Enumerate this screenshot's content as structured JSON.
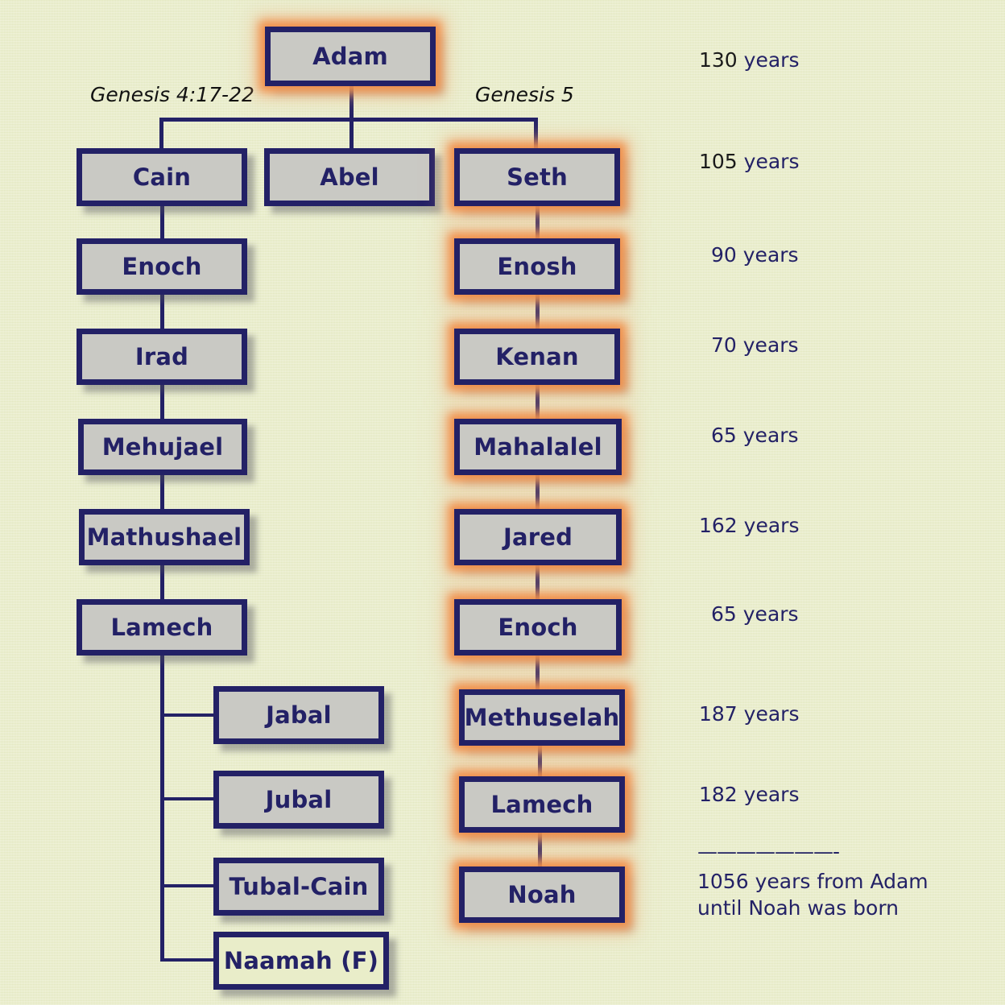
{
  "page": {
    "background_color": "#e9edc9",
    "box_fill": "#c9c9c4",
    "ink_color": "#232166",
    "glow_color": "#f08c46"
  },
  "captions": {
    "left": "Genesis 4:17-22",
    "right": "Genesis 5"
  },
  "root": {
    "label": "Adam"
  },
  "sons": [
    {
      "label": "Cain"
    },
    {
      "label": "Abel"
    },
    {
      "label": "Seth"
    }
  ],
  "cain_line": [
    {
      "label": "Enoch"
    },
    {
      "label": "Irad"
    },
    {
      "label": "Mehujael"
    },
    {
      "label": "Mathushael"
    },
    {
      "label": "Lamech"
    }
  ],
  "lamech_children": [
    {
      "label": "Jabal"
    },
    {
      "label": "Jubal"
    },
    {
      "label": "Tubal-Cain"
    },
    {
      "label": "Naamah (F)"
    }
  ],
  "seth_line": [
    {
      "label": "Enosh"
    },
    {
      "label": "Kenan"
    },
    {
      "label": "Mahalalel"
    },
    {
      "label": "Jared"
    },
    {
      "label": "Enoch"
    },
    {
      "label": "Methuselah"
    },
    {
      "label": "Lamech"
    },
    {
      "label": "Noah"
    }
  ],
  "years": [
    {
      "number": "130",
      "unit": "years"
    },
    {
      "number": "105",
      "unit": "years"
    },
    {
      "number": "90",
      "unit": "years"
    },
    {
      "number": "70",
      "unit": "years"
    },
    {
      "number": "65",
      "unit": "years"
    },
    {
      "number": "162",
      "unit": "years"
    },
    {
      "number": "65",
      "unit": "years"
    },
    {
      "number": "187",
      "unit": "years"
    },
    {
      "number": "182",
      "unit": "years"
    }
  ],
  "footer": {
    "rule": "———————-",
    "line1": "1056 years from Adam",
    "line2": "until Noah was born"
  }
}
